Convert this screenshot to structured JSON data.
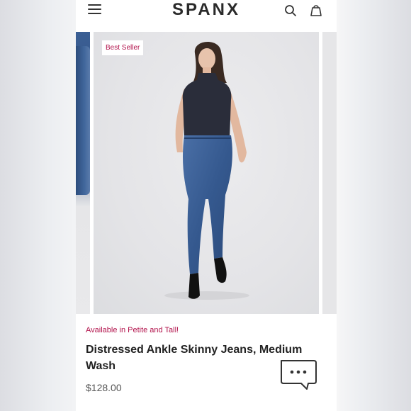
{
  "header": {
    "logo_text": "SPANX",
    "menu_icon": "hamburger-menu-icon",
    "search_icon": "search-icon",
    "bag_icon": "shopping-bag-icon"
  },
  "carousel": {
    "badge": "Best Seller"
  },
  "product": {
    "availability": "Available in Petite and Tall!",
    "title": "Distressed Ankle Skinny Jeans, Medium Wash",
    "price": "$128.00"
  },
  "chat": {
    "icon": "chat-bubble-icon"
  },
  "colors": {
    "accent": "#b2124b",
    "text": "#222222",
    "denim": "#3b5f94"
  }
}
